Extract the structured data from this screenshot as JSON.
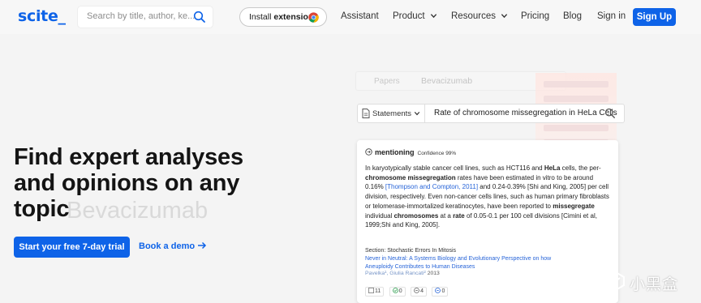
{
  "brand": {
    "logo_text": "scite_",
    "accent": "#0e63e8"
  },
  "nav": {
    "search_placeholder": "Search by title, author, ke...",
    "extension_label_pre": "Install ",
    "extension_label_bold": "extension!",
    "links": {
      "assistant": "Assistant",
      "product": "Product",
      "resources": "Resources",
      "pricing": "Pricing",
      "blog": "Blog",
      "signin": "Sign in"
    },
    "signup": "Sign Up"
  },
  "hero": {
    "title": "Find expert analyses and opinions on any topic",
    "ghost_text": "Bevacizumab",
    "cta_primary": "Start your free 7-day trial",
    "cta_secondary": "Book a demo"
  },
  "background_mockup": {
    "select_label": "Papers",
    "query": "Bevacizumab"
  },
  "statements_search": {
    "select_label": "Statements",
    "query": "Rate of chromosome missegregation in HeLa Cells"
  },
  "citation_card": {
    "type_label": "mentioning",
    "confidence": "Confidence 99%",
    "excerpt_parts": {
      "p1": "In karyotypically stable cancer cell lines, such as HCT116 and ",
      "p2": "HeLa",
      "p3": " cells, the per-",
      "p4": "chromosome missegregation",
      "p5": " rates have been estimated in vitro to be around 0.16% ",
      "p6": "[Thompson and Compton, 2011]",
      "p7": " and 0.24-0.39% [Shi and King, 2005] per cell division, respectively. Even non-cancer cells lines, such as human primary fibroblasts or telomerase-immortalized keratinocytes, have been reported to ",
      "p8": "missegregate",
      "p9": " individual ",
      "p10": "chromosomes",
      "p11": " at a ",
      "p12": "rate",
      "p13": " of 0.05-0.1 per 100 cell divisions [Cimini et al, 1999;Shi and King, 2005]."
    },
    "section": "Section: Stochastic Errors In Mitosis",
    "paper_title": "Never in Neutral: A Systems Biology and Evolutionary Perspective on how Aneuploidy Contributes to Human Diseases",
    "authors": "Pavelka¹, Giulia Rancati²",
    "year": "2013",
    "badges": {
      "total": "11",
      "supporting": "0",
      "contrasting": "4",
      "mentioning": "0"
    }
  },
  "watermark": {
    "text": "小黑盒"
  }
}
